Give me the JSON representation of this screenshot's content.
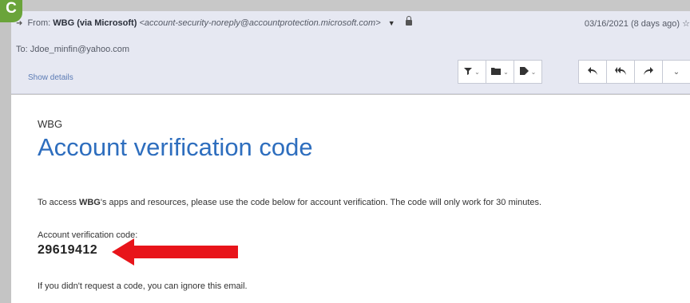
{
  "badge": "C",
  "header": {
    "from_prefix": "From:",
    "sender_name": "WBG (via Microsoft)",
    "sender_email": "<account-security-noreply@accountprotection.microsoft.com>",
    "date": "03/16/2021 (8 days ago) ☆",
    "to_label": "To:",
    "to_address": "Jdoe_minfin@yahoo.com",
    "show_details": "Show details"
  },
  "toolbar": {
    "group1": [
      {
        "icon": "filter-icon",
        "glyph": "▼"
      },
      {
        "icon": "folder-icon",
        "glyph": "▆"
      },
      {
        "icon": "tag-icon",
        "glyph": "◆"
      }
    ],
    "group2": [
      {
        "icon": "reply-icon",
        "glyph": "↰"
      },
      {
        "icon": "reply-all-icon",
        "glyph": "⇇"
      },
      {
        "icon": "forward-icon",
        "glyph": "↱"
      },
      {
        "icon": "more-chevron-icon",
        "glyph": "⌄"
      }
    ]
  },
  "email": {
    "org": "WBG",
    "title": "Account verification code",
    "para_prefix": "To access ",
    "para_org": "WBG",
    "para_rest": "'s apps and resources, please use the code below for account verification. The code will only work for 30 minutes.",
    "code_label": "Account verification code:",
    "code": "29619412",
    "ignore": "If you didn't request a code, you can ignore this email."
  },
  "colors": {
    "accent": "#2e6ebe",
    "arrow": "#e8141a",
    "badge": "#6aa43a"
  }
}
